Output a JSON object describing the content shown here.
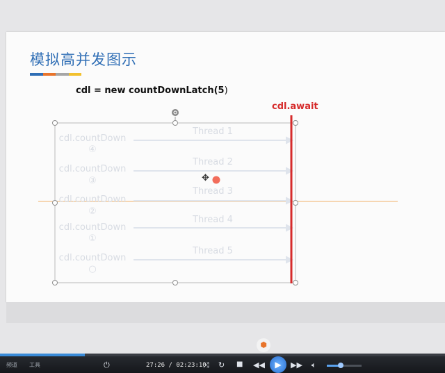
{
  "slide": {
    "title": "模拟高并发图示",
    "title_bar_colors": [
      "#2f6eb5",
      "#e8742b",
      "#a6a6a6",
      "#f2c12e"
    ],
    "code_text": "cdl = new countDownLatch(5",
    "code_paren": ")",
    "await_label": "cdl.await",
    "await_color": "#d62b2b",
    "rows": [
      {
        "label": "cdl.countDown",
        "count": "④",
        "thread": "Thread 1"
      },
      {
        "label": "cdl.countDown",
        "count": "③",
        "thread": "Thread 2"
      },
      {
        "label": "cdl.countDown",
        "count": "②",
        "thread": "Thread 3"
      },
      {
        "label": "cdl.countDown",
        "count": "①",
        "thread": "Thread 4"
      },
      {
        "label": "cdl.countDown",
        "count": "○",
        "thread": "Thread 5"
      }
    ]
  },
  "player": {
    "tab1": "频道",
    "tab2": "工具",
    "time": "27:26 / 02:23:10",
    "progress_fraction": 0.19,
    "volume_fraction": 0.4,
    "icons": [
      "power-icon",
      "shuffle-icon",
      "repeat-icon",
      "stop-icon",
      "rewind-icon",
      "play-icon",
      "fast-forward-icon",
      "volume-icon"
    ]
  }
}
